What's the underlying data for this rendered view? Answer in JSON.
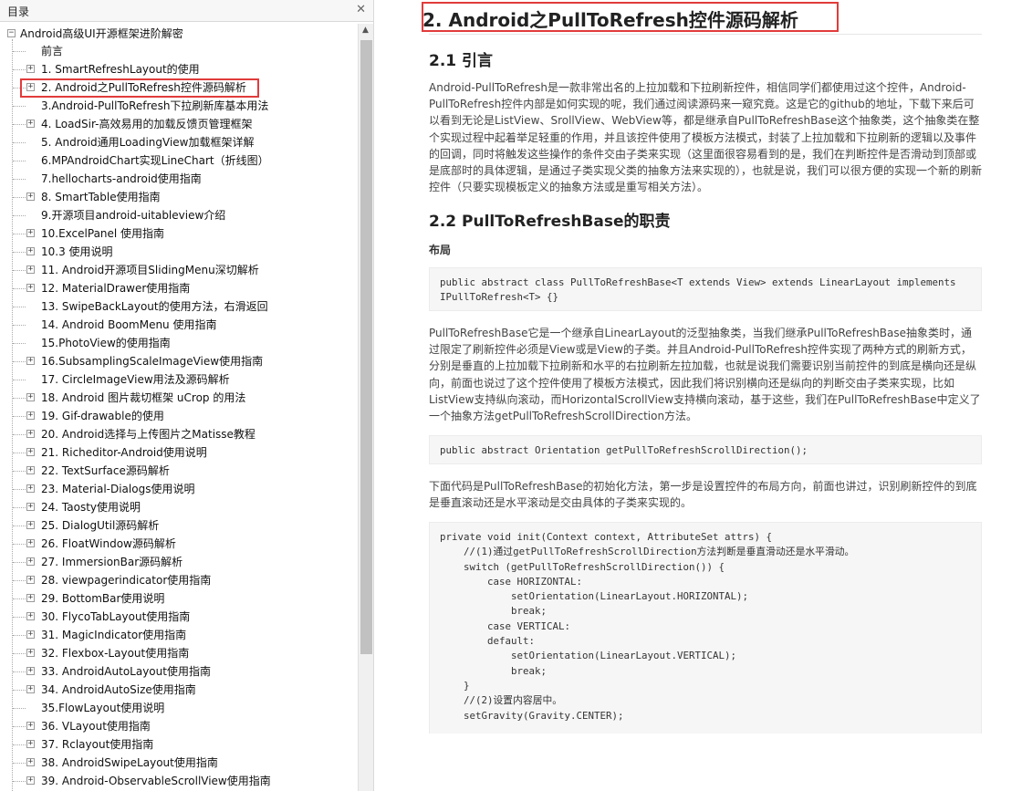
{
  "sidebar": {
    "title": "目录",
    "close_icon": "close-icon",
    "root": {
      "label": "Android高级UI开源框架进阶解密",
      "expander": "⊟"
    },
    "items": [
      {
        "label": "前言",
        "expander": ""
      },
      {
        "label": "1. SmartRefreshLayout的使用",
        "expander": "⊞"
      },
      {
        "label": "2. Android之PullToRefresh控件源码解析",
        "expander": "⊞"
      },
      {
        "label": "3.Android-PullToRefresh下拉刷新库基本用法",
        "expander": ""
      },
      {
        "label": "4. LoadSir-高效易用的加载反馈页管理框架",
        "expander": "⊞"
      },
      {
        "label": "5. Android通用LoadingView加载框架详解",
        "expander": ""
      },
      {
        "label": "6.MPAndroidChart实现LineChart（折线图）",
        "expander": ""
      },
      {
        "label": "7.hellocharts-android使用指南",
        "expander": ""
      },
      {
        "label": "8. SmartTable使用指南",
        "expander": "⊞"
      },
      {
        "label": "9.开源项目android-uitableview介绍",
        "expander": ""
      },
      {
        "label": "10.ExcelPanel 使用指南",
        "expander": "⊞"
      },
      {
        "label": "10.3 使用说明",
        "expander": "⊞"
      },
      {
        "label": "11. Android开源项目SlidingMenu深切解析",
        "expander": "⊞"
      },
      {
        "label": "12. MaterialDrawer使用指南",
        "expander": "⊞"
      },
      {
        "label": "13. SwipeBackLayout的使用方法，右滑返回",
        "expander": ""
      },
      {
        "label": "14. Android BoomMenu 使用指南",
        "expander": ""
      },
      {
        "label": "15.PhotoView的使用指南",
        "expander": ""
      },
      {
        "label": "16.SubsamplingScaleImageView使用指南",
        "expander": "⊞"
      },
      {
        "label": "17. CircleImageView用法及源码解析",
        "expander": ""
      },
      {
        "label": "18. Android 图片裁切框架 uCrop 的用法",
        "expander": "⊞"
      },
      {
        "label": "19. Gif-drawable的使用",
        "expander": "⊞"
      },
      {
        "label": "20. Android选择与上传图片之Matisse教程",
        "expander": "⊞"
      },
      {
        "label": "21. Richeditor-Android使用说明",
        "expander": "⊞"
      },
      {
        "label": "22. TextSurface源码解析",
        "expander": "⊞"
      },
      {
        "label": "23. Material-Dialogs使用说明",
        "expander": "⊞"
      },
      {
        "label": "24. Taosty使用说明",
        "expander": "⊞"
      },
      {
        "label": "25. DialogUtil源码解析",
        "expander": "⊞"
      },
      {
        "label": "26. FloatWindow源码解析",
        "expander": "⊞"
      },
      {
        "label": "27. ImmersionBar源码解析",
        "expander": "⊞"
      },
      {
        "label": "28. viewpagerindicator使用指南",
        "expander": "⊞"
      },
      {
        "label": "29. BottomBar使用说明",
        "expander": "⊞"
      },
      {
        "label": "30. FlycoTabLayout使用指南",
        "expander": "⊞"
      },
      {
        "label": "31. MagicIndicator使用指南",
        "expander": "⊞"
      },
      {
        "label": "32. Flexbox-Layout使用指南",
        "expander": "⊞"
      },
      {
        "label": "33. AndroidAutoLayout使用指南",
        "expander": "⊞"
      },
      {
        "label": "34. AndroidAutoSize使用指南",
        "expander": "⊞"
      },
      {
        "label": "35.FlowLayout使用说明",
        "expander": ""
      },
      {
        "label": "36. VLayout使用指南",
        "expander": "⊞"
      },
      {
        "label": "37. Rclayout使用指南",
        "expander": "⊞"
      },
      {
        "label": "38. AndroidSwipeLayout使用指南",
        "expander": "⊞"
      },
      {
        "label": "39. Android-ObservableScrollView使用指南",
        "expander": "⊞"
      }
    ]
  },
  "content": {
    "title": "2. Android之PullToRefresh控件源码解析",
    "section1_heading": "2.1 引言",
    "section1_para": "Android-PullToRefresh是一款非常出名的上拉加载和下拉刷新控件，相信同学们都使用过这个控件，Android-PullToRefresh控件内部是如何实现的呢，我们通过阅读源码来一窥究竟。这是它的github的地址，下载下来后可以看到无论是ListView、SrollView、WebView等，都是继承自PullToRefreshBase这个抽象类，这个抽象类在整个实现过程中起着举足轻重的作用，并且该控件使用了模板方法模式，封装了上拉加载和下拉刷新的逻辑以及事件的回调，同时将触发这些操作的条件交由子类来实现（这里面很容易看到的是，我们在判断控件是否滑动到顶部或是底部时的具体逻辑，是通过子类实现父类的抽象方法来实现的），也就是说，我们可以很方便的实现一个新的刷新控件（只要实现模板定义的抽象方法或是重写相关方法）。",
    "section2_heading": "2.2 PullToRefreshBase的职责",
    "layout_label": "布局",
    "code1": "public abstract class PullToRefreshBase<T extends View> extends LinearLayout implements\nIPullToRefresh<T> {}",
    "para2": "PullToRefreshBase它是一个继承自LinearLayout的泛型抽象类，当我们继承PullToRefreshBase抽象类时，通过限定了刷新控件必须是View或是View的子类。并且Android-PullToRefresh控件实现了两种方式的刷新方式，分别是垂直的上拉加载下拉刷新和水平的右拉刷新左拉加载，也就是说我们需要识别当前控件的到底是横向还是纵向，前面也说过了这个控件使用了模板方法模式，因此我们将识别横向还是纵向的判断交由子类来实现，比如ListView支持纵向滚动，而HorizontalScrollView支持横向滚动，基于这些，我们在PullToRefreshBase中定义了一个抽象方法getPullToRefreshScrollDirection方法。",
    "code2": "public abstract Orientation getPullToRefreshScrollDirection();",
    "para3": "下面代码是PullToRefreshBase的初始化方法，第一步是设置控件的布局方向，前面也讲过，识别刷新控件的到底是垂直滚动还是水平滚动是交由具体的子类来实现的。",
    "code3": "private void init(Context context, AttributeSet attrs) {\n    //(1)通过getPullToRefreshScrollDirection方法判断是垂直滑动还是水平滑动。\n    switch (getPullToRefreshScrollDirection()) {\n        case HORIZONTAL:\n            setOrientation(LinearLayout.HORIZONTAL);\n            break;\n        case VERTICAL:\n        default:\n            setOrientation(LinearLayout.VERTICAL);\n            break;\n    }\n    //(2)设置内容居中。\n    setGravity(Gravity.CENTER);"
  },
  "colors": {
    "highlight_border": "#e23b3b",
    "code_bg": "#f6f6f6"
  }
}
